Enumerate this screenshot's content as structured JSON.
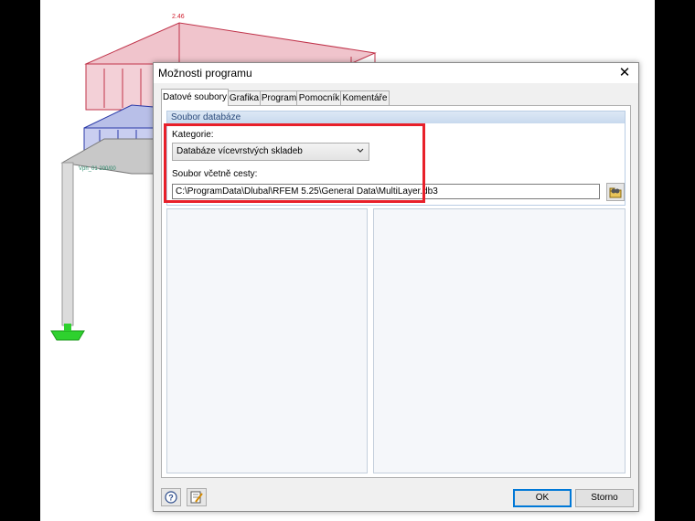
{
  "background_model": {
    "load_value_label": "2.46",
    "member_label": "Vph_01 200/00"
  },
  "dialog": {
    "title": "Možnosti programu",
    "close_glyph": "✕",
    "tabs": [
      {
        "label": "Datové soubory",
        "active": true
      },
      {
        "label": "Grafika",
        "active": false
      },
      {
        "label": "Program",
        "active": false
      },
      {
        "label": "Pomocník",
        "active": false
      },
      {
        "label": "Komentáře",
        "active": false
      }
    ],
    "group": {
      "title": "Soubor databáze",
      "category_label": "Kategorie:",
      "category_value": "Databáze vícevrstvých skladeb",
      "path_label": "Soubor včetně cesty:",
      "path_value": "C:\\ProgramData\\Dlubal\\RFEM 5.25\\General Data\\MultiLayer.db3"
    },
    "buttons": {
      "ok": "OK",
      "cancel": "Storno"
    },
    "icons": [
      "help-icon",
      "edit-note-icon",
      "browse-folder-icon",
      "chevron-down-icon",
      "close-icon"
    ]
  },
  "colors": {
    "highlight": "#e8202a",
    "load_red": "#e8a6b4",
    "load_blue": "#9aa6e0",
    "support_green": "#2ed12e"
  }
}
